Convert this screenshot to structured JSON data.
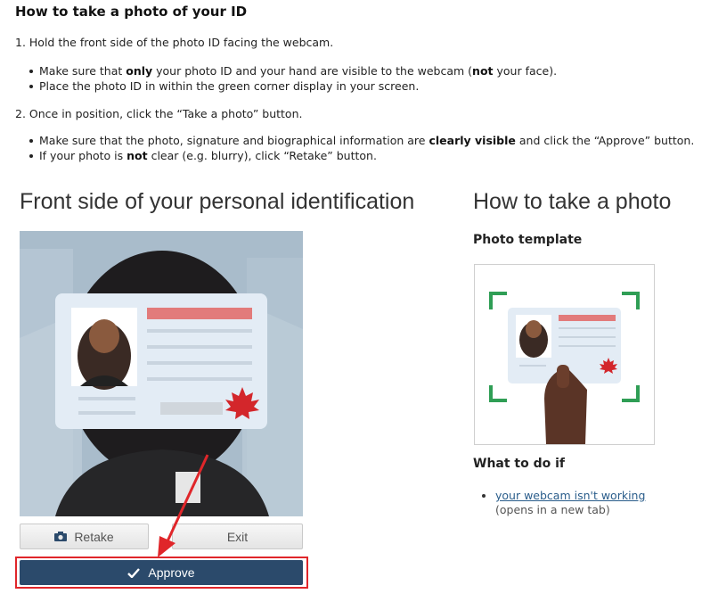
{
  "instructions": {
    "title": "How to take a photo of your ID",
    "step1": "1. Hold the front side of the photo ID facing the webcam.",
    "step1_bullets": [
      {
        "pre": "Make sure that ",
        "b1": "only",
        "mid": " your photo ID and your hand are visible to the webcam (",
        "b2": "not",
        "post": " your face)."
      },
      {
        "text": "Place the photo ID in within the green corner display in your screen."
      }
    ],
    "step2": "2. Once in position, click the “Take a photo” button.",
    "step2_bullets": [
      {
        "pre": "Make sure that the photo, signature and biographical information are ",
        "b1": "clearly visible",
        "post": " and click the “Approve” button."
      },
      {
        "pre": "If your photo is ",
        "b1": "not",
        "post": " clear (e.g. blurry), click “Retake” button."
      }
    ]
  },
  "left_panel": {
    "heading": "Front side of your personal identification",
    "retake_label": "Retake",
    "exit_label": "Exit",
    "approve_label": "Approve"
  },
  "right_panel": {
    "heading": "How to take a photo",
    "template_label": "Photo template",
    "what_to_do_label": "What to do if",
    "link_text": "your webcam isn't working",
    "link_suffix": " (opens in a new tab)"
  },
  "colors": {
    "approve_bg": "#2b4a6b",
    "highlight_red": "#e0262a",
    "corner_green": "#2f9e55",
    "id_red_bar": "#e27b7b",
    "maple_red": "#d3262b"
  },
  "icons": [
    "camera-icon",
    "check-icon",
    "maple-leaf-icon",
    "annotation-arrow"
  ]
}
